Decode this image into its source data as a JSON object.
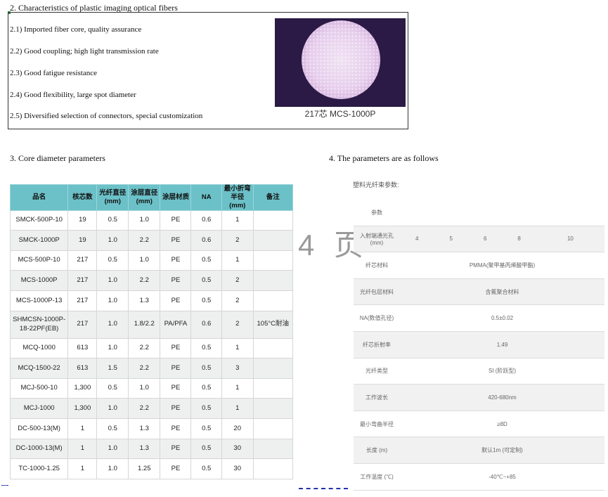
{
  "section2": {
    "title": "2. Characteristics of plastic imaging optical fibers",
    "features": [
      "2.1) Imported fiber core, quality assurance",
      "2.2) Good coupling; high light transmission rate",
      "2.3) Good fatigue resistance",
      "2.4) Good flexibility, large spot diameter",
      "2.5) Diversified selection of connectors, special customization"
    ],
    "image_caption": "217芯   MCS-1000P"
  },
  "section3": {
    "title": "3. Core diameter parameters",
    "headers": [
      "品名",
      "核芯数",
      "光纤直径\n(mm)",
      "涂层直径\n(mm)",
      "涂层材质",
      "NA",
      "最小折弯\n半径(mm)",
      "备注"
    ],
    "rows": [
      [
        "SMCK-500P-10",
        "19",
        "0.5",
        "1.0",
        "PE",
        "0.6",
        "1",
        ""
      ],
      [
        "SMCK-1000P",
        "19",
        "1.0",
        "2.2",
        "PE",
        "0.6",
        "2",
        ""
      ],
      [
        "MCS-500P-10",
        "217",
        "0.5",
        "1.0",
        "PE",
        "0.5",
        "1",
        ""
      ],
      [
        "MCS-1000P",
        "217",
        "1.0",
        "2.2",
        "PE",
        "0.5",
        "2",
        ""
      ],
      [
        "MCS-1000P-13",
        "217",
        "1.0",
        "1.3",
        "PE",
        "0.5",
        "2",
        ""
      ],
      [
        "SHMCSN-1000P-18-22PF(EB)",
        "217",
        "1.0",
        "1.8/2.2",
        "PA/PFA",
        "0.6",
        "2",
        "105°C耐油"
      ],
      [
        "MCQ-1000",
        "613",
        "1.0",
        "2.2",
        "PE",
        "0.5",
        "1",
        ""
      ],
      [
        "MCQ-1500-22",
        "613",
        "1.5",
        "2.2",
        "PE",
        "0.5",
        "3",
        ""
      ],
      [
        "MCJ-500-10",
        "1,300",
        "0.5",
        "1.0",
        "PE",
        "0.5",
        "1",
        ""
      ],
      [
        "MCJ-1000",
        "1,300",
        "1.0",
        "2.2",
        "PE",
        "0.5",
        "1",
        ""
      ],
      [
        "DC-500-13(M)",
        "1",
        "0.5",
        "1.3",
        "PE",
        "0.5",
        "20",
        ""
      ],
      [
        "DC-1000-13(M)",
        "1",
        "1.0",
        "1.3",
        "PE",
        "0.5",
        "30",
        ""
      ],
      [
        "TC-1000-1.25",
        "1",
        "1.0",
        "1.25",
        "PE",
        "0.5",
        "30",
        ""
      ]
    ]
  },
  "section4": {
    "title": "4. The parameters are as follows",
    "subtitle": "塑料光纤束参数:",
    "header_label": "参数",
    "rows": [
      {
        "label": "入射端通光孔 (mm)",
        "values": [
          "4",
          "5",
          "6",
          "8",
          "10"
        ]
      },
      {
        "label": "纤芯材料",
        "value": "PMMA(聚甲基丙烯酸甲酯)"
      },
      {
        "label": "光纤包层材料",
        "value": "含氟聚合材料"
      },
      {
        "label": "NA(数值孔径)",
        "value": "0.5±0.02"
      },
      {
        "label": "纤芯折射率",
        "value": "1.49"
      },
      {
        "label": "光纤类型",
        "value": "SI (阶跃型)"
      },
      {
        "label": "工作波长",
        "value": "420-680nm"
      },
      {
        "label": "最小弯曲半径",
        "value": "≥8D"
      },
      {
        "label": "长度 (m)",
        "value": "默认1m (可定制)"
      },
      {
        "label": "工作温度 (℃)",
        "value": "-40℃~+85"
      }
    ]
  },
  "watermark": "4 页"
}
